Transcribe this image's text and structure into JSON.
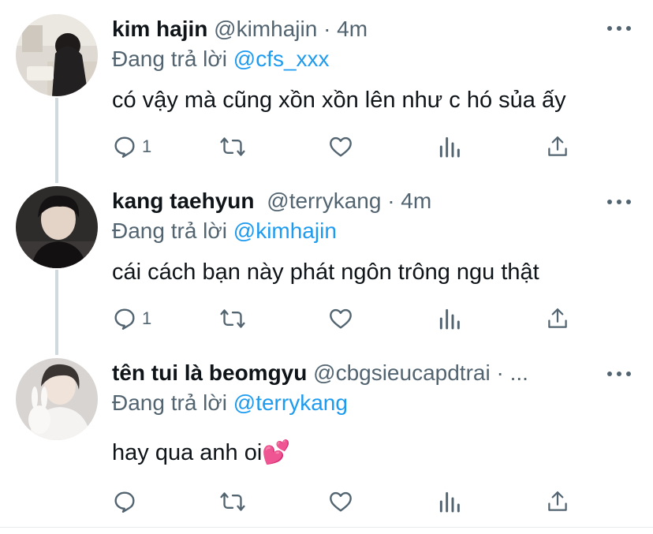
{
  "tweets": [
    {
      "name": "kim hajin",
      "handle": "@kimhajin",
      "time": "· 4m",
      "reply_prefix": "Đang trả lời",
      "reply_to": "@cfs_xxx",
      "text": "có vậy mà cũng xồn xồn lên như c hó sủa ấy",
      "reply_count": "1",
      "avatar_icon": "avatar-photo-girl-desk"
    },
    {
      "name": "kang taehyun",
      "handle": "@terrykang",
      "time": "· 4m",
      "reply_prefix": "Đang trả lời",
      "reply_to": "@kimhajin",
      "text": "cái cách bạn này phát ngôn trông ngu thật",
      "reply_count": "1",
      "avatar_icon": "avatar-photo-boy-dark"
    },
    {
      "name": "tên tui là beomgyu",
      "handle": "@cbgsieucapdtrai",
      "time": "· ...",
      "reply_prefix": "Đang trả lời",
      "reply_to": "@terrykang",
      "text": "hay qua anh oi",
      "emoji": "💕",
      "reply_count": "",
      "avatar_icon": "avatar-photo-boy-plush"
    }
  ],
  "icons": {
    "reply": "comment-icon",
    "retweet": "retweet-icon",
    "like": "heart-icon",
    "stats": "analytics-icon",
    "share": "share-icon",
    "more": "more-icon"
  },
  "colors": {
    "name": "#0f1419",
    "secondary": "#536471",
    "mention": "#1d9bf0",
    "thread_line": "#cfd9de",
    "divider": "#e6ecf0"
  }
}
